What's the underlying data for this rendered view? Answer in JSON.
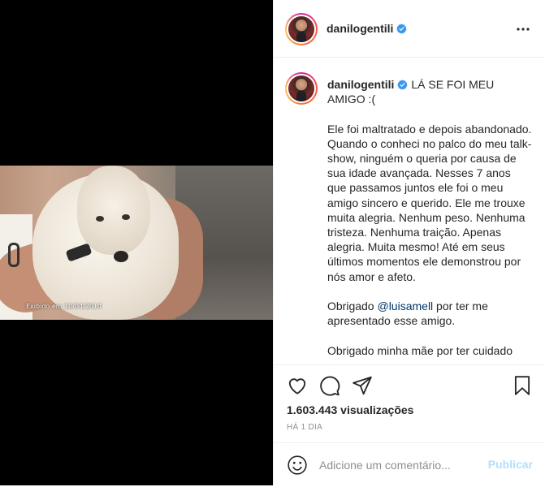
{
  "media": {
    "video_caption": "Exibido em 10/04/2014"
  },
  "header": {
    "username": "danilogentili",
    "more_icon": "ellipsis-icon"
  },
  "caption": {
    "username": "danilogentili",
    "title": "LÁ SE FOI MEU AMIGO :(",
    "paragraph1": "Ele foi maltratado e depois abandonado. Quando o conheci no palco do meu talk-show, ninguém o queria por causa de sua idade avançada. Nesses 7 anos que passamos juntos ele foi o meu amigo sincero e querido. Ele me trouxe muita alegria. Nenhum peso. Nenhuma tristeza. Nenhuma traição. Apenas alegria. Muita mesmo! Até em seus últimos momentos ele demonstrou por nós amor e afeto.",
    "thanks_prefix": "Obrigado ",
    "thanks_mention": "@luisamell",
    "thanks_suffix": " por ter me apresentado esse amigo.",
    "paragraph3": "Obrigado minha mãe por ter cuidado"
  },
  "actions": {
    "like_icon": "heart-icon",
    "comment_icon": "comment-icon",
    "share_icon": "share-icon",
    "save_icon": "bookmark-icon",
    "views": "1.603.443 visualizações",
    "time": "HÁ 1 DIA"
  },
  "add_comment": {
    "placeholder": "Adicione um comentário...",
    "publish_label": "Publicar"
  },
  "colors": {
    "verified": "#3897f0",
    "publish_disabled": "#b2dffc",
    "mention": "#00376b"
  }
}
